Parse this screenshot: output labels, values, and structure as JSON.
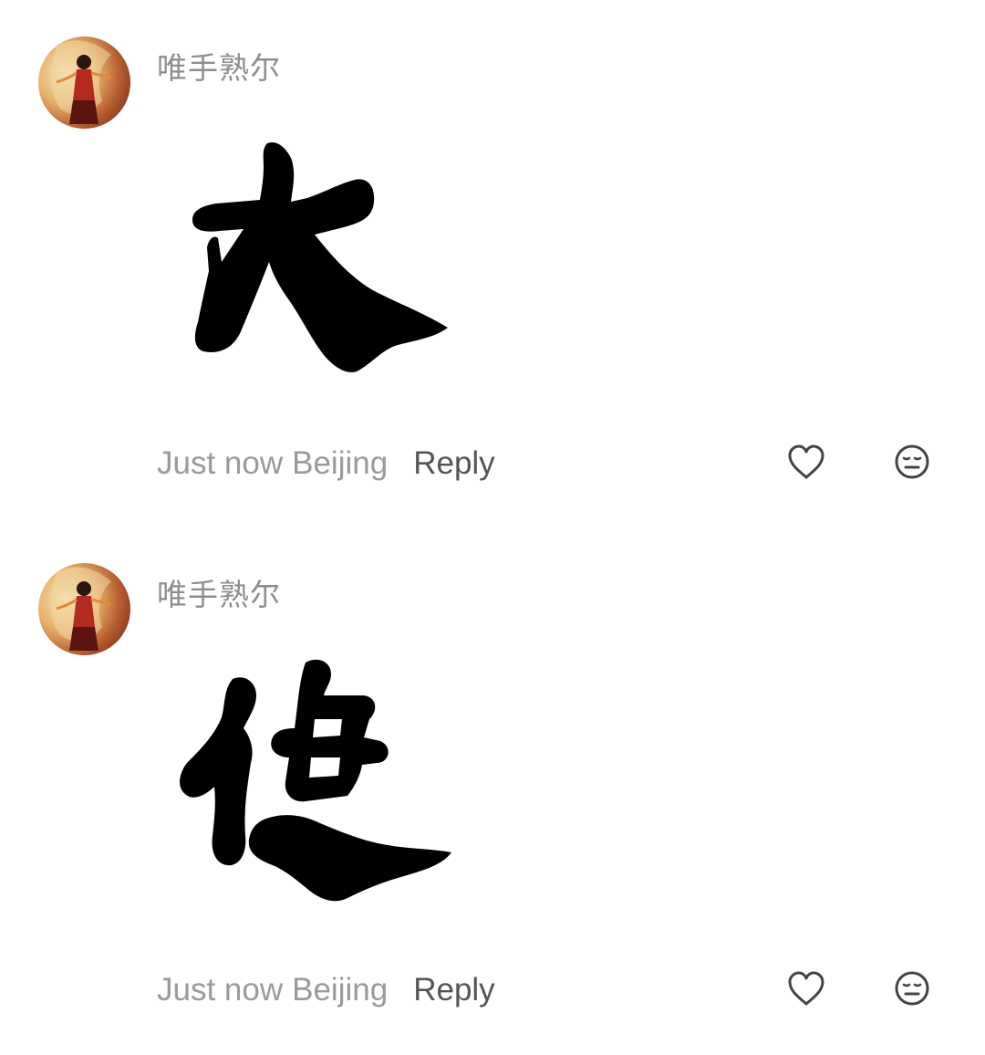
{
  "comments": [
    {
      "avatar_icon": "user-avatar",
      "username": "唯手熟尔",
      "sticker_character": "大",
      "time": "Just now",
      "location": "Beijing",
      "reply_label": "Reply",
      "like_icon": "heart-outline-icon",
      "emoji_icon": "smiley-face-icon"
    },
    {
      "avatar_icon": "user-avatar",
      "username": "唯手熟尔",
      "sticker_character": "傻",
      "time": "Just now",
      "location": "Beijing",
      "reply_label": "Reply",
      "like_icon": "heart-outline-icon",
      "emoji_icon": "smiley-face-icon"
    }
  ],
  "colors": {
    "username": "#8e8e8e",
    "meta": "#9a9a9a",
    "reply": "#555555",
    "icon": "#444444",
    "sticker": "#000000"
  }
}
